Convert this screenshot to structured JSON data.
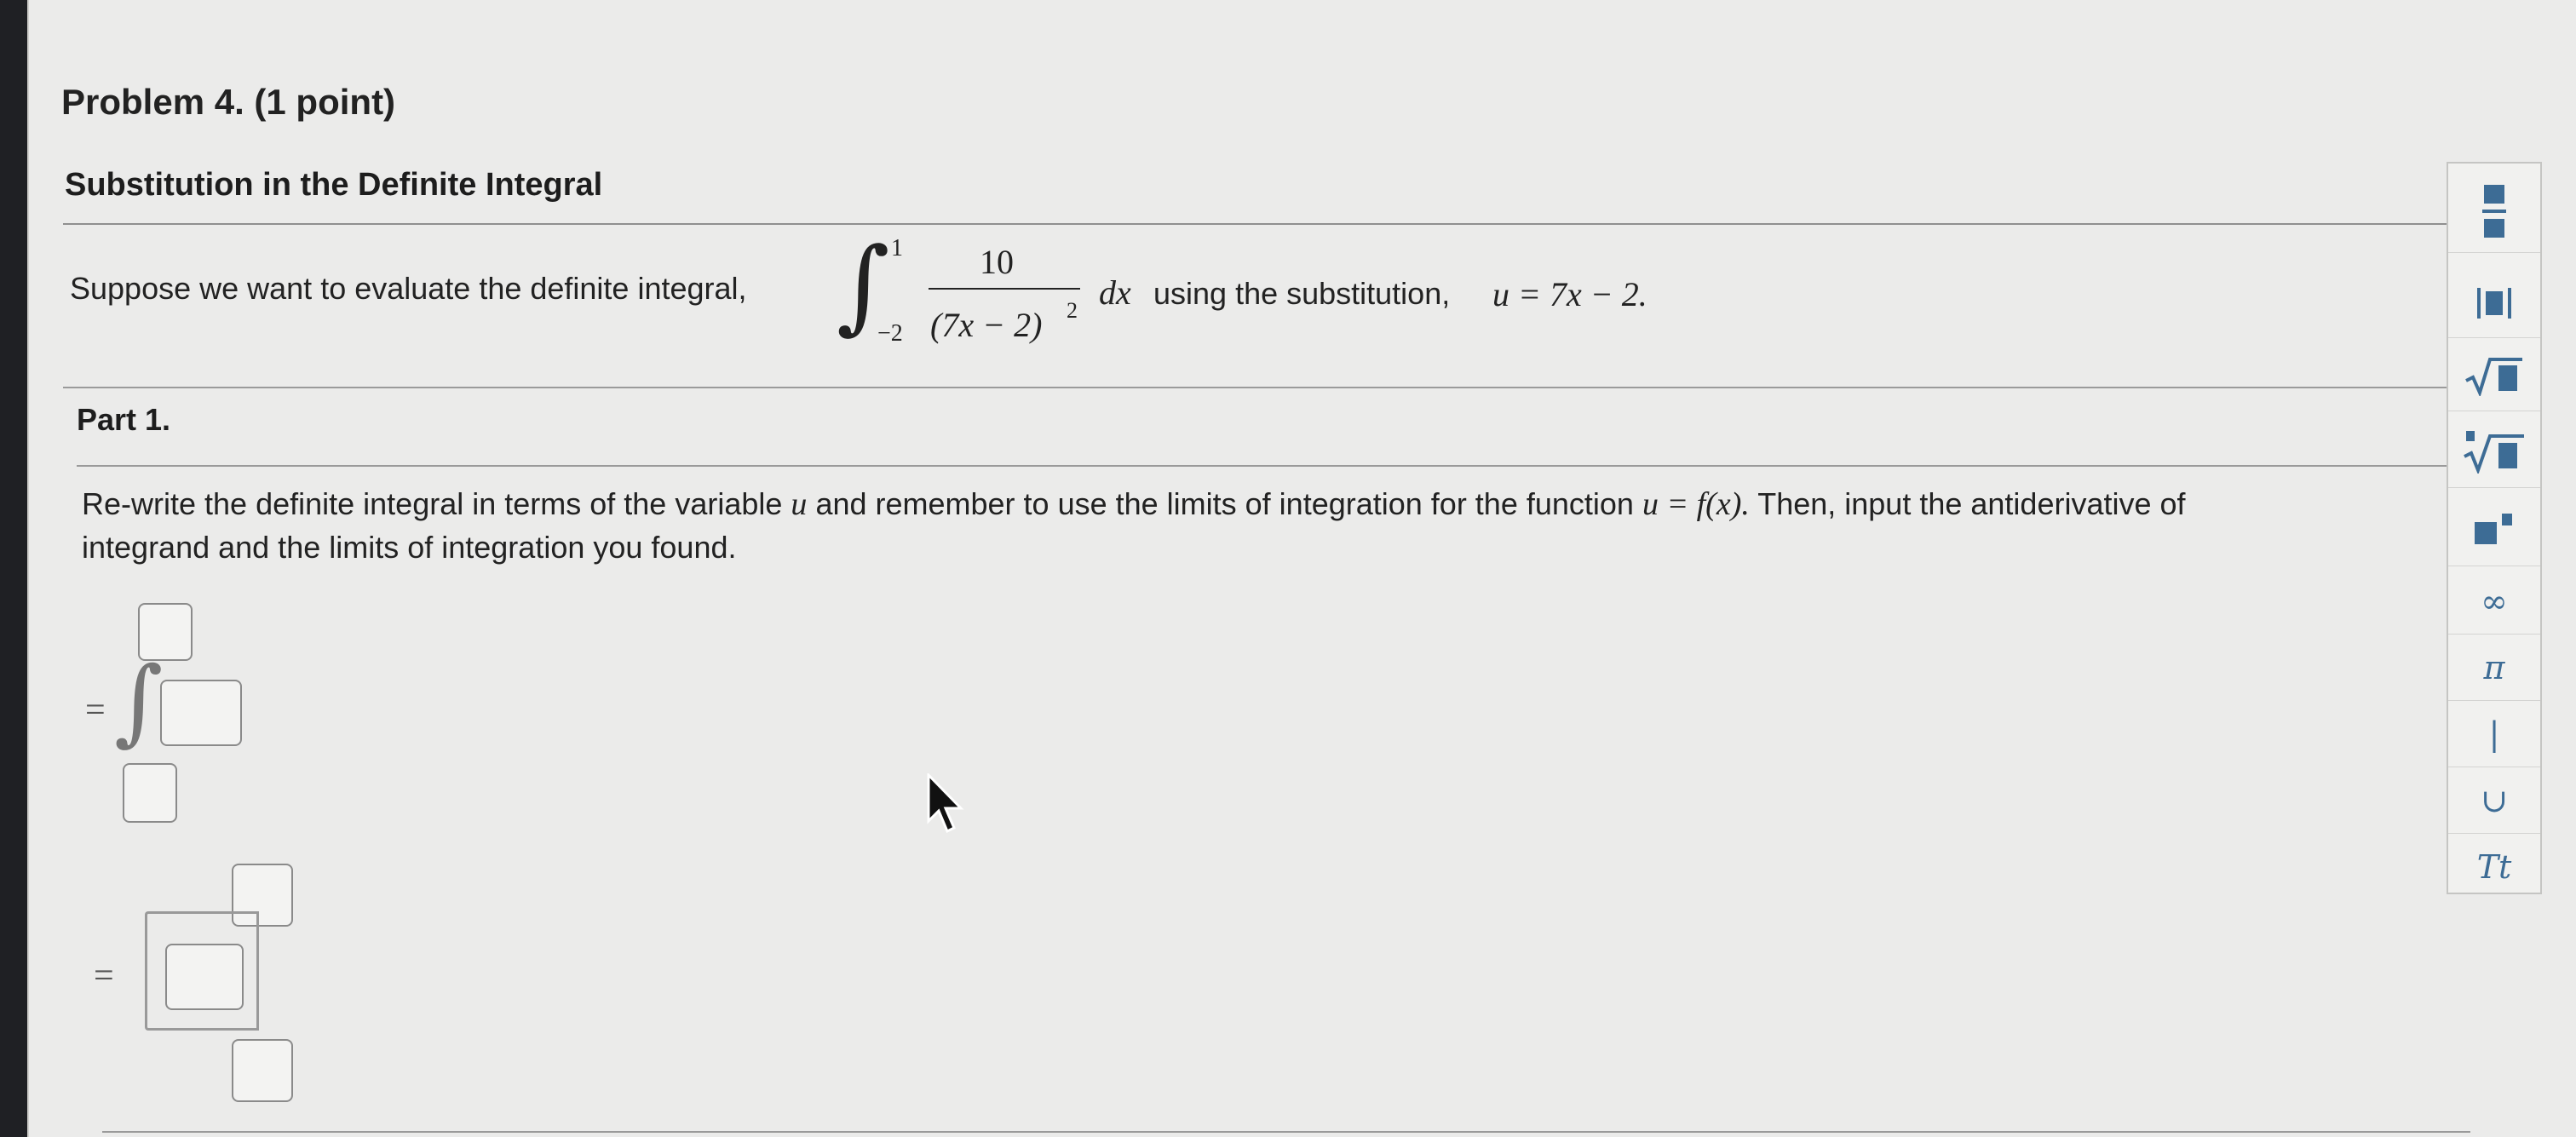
{
  "problem": {
    "title": "Problem 4.",
    "points": "(1 point)",
    "section_title": "Substitution in the Definite Integral"
  },
  "statement": {
    "prefix": "Suppose we want to evaluate the definite integral,",
    "upper_limit": "1",
    "lower_limit": "−2",
    "numerator": "10",
    "denominator": "(7x − 2)",
    "exponent": "2",
    "dx": "dx",
    "middle_text": "using the substitution,",
    "substitution": "u = 7x − 2."
  },
  "part1": {
    "title": "Part 1.",
    "instruction_line1_a": "Re-write the definite integral in terms of the variable",
    "var_u": "u",
    "instruction_line1_b": "and remember to use the limits of integration for the function",
    "function": "u = f(x).",
    "instruction_line1_c": "Then, input the antiderivative of",
    "instruction_line2": "integrand and the limits of integration you found.",
    "equals": "="
  },
  "toolbar": {
    "items": [
      {
        "name": "fraction-tool-icon"
      },
      {
        "name": "absolute-value-tool-icon"
      },
      {
        "name": "square-root-tool-icon"
      },
      {
        "name": "nth-root-tool-icon"
      },
      {
        "name": "exponent-tool-icon"
      },
      {
        "name": "infinity-tool-icon",
        "label": "∞"
      },
      {
        "name": "pi-tool-icon",
        "label": "π"
      },
      {
        "name": "vertical-bar-tool-icon",
        "label": "|"
      },
      {
        "name": "union-tool-icon",
        "label": "∪"
      },
      {
        "name": "text-tool-icon",
        "label": "Tt"
      }
    ],
    "accent": "#3d6c95"
  }
}
